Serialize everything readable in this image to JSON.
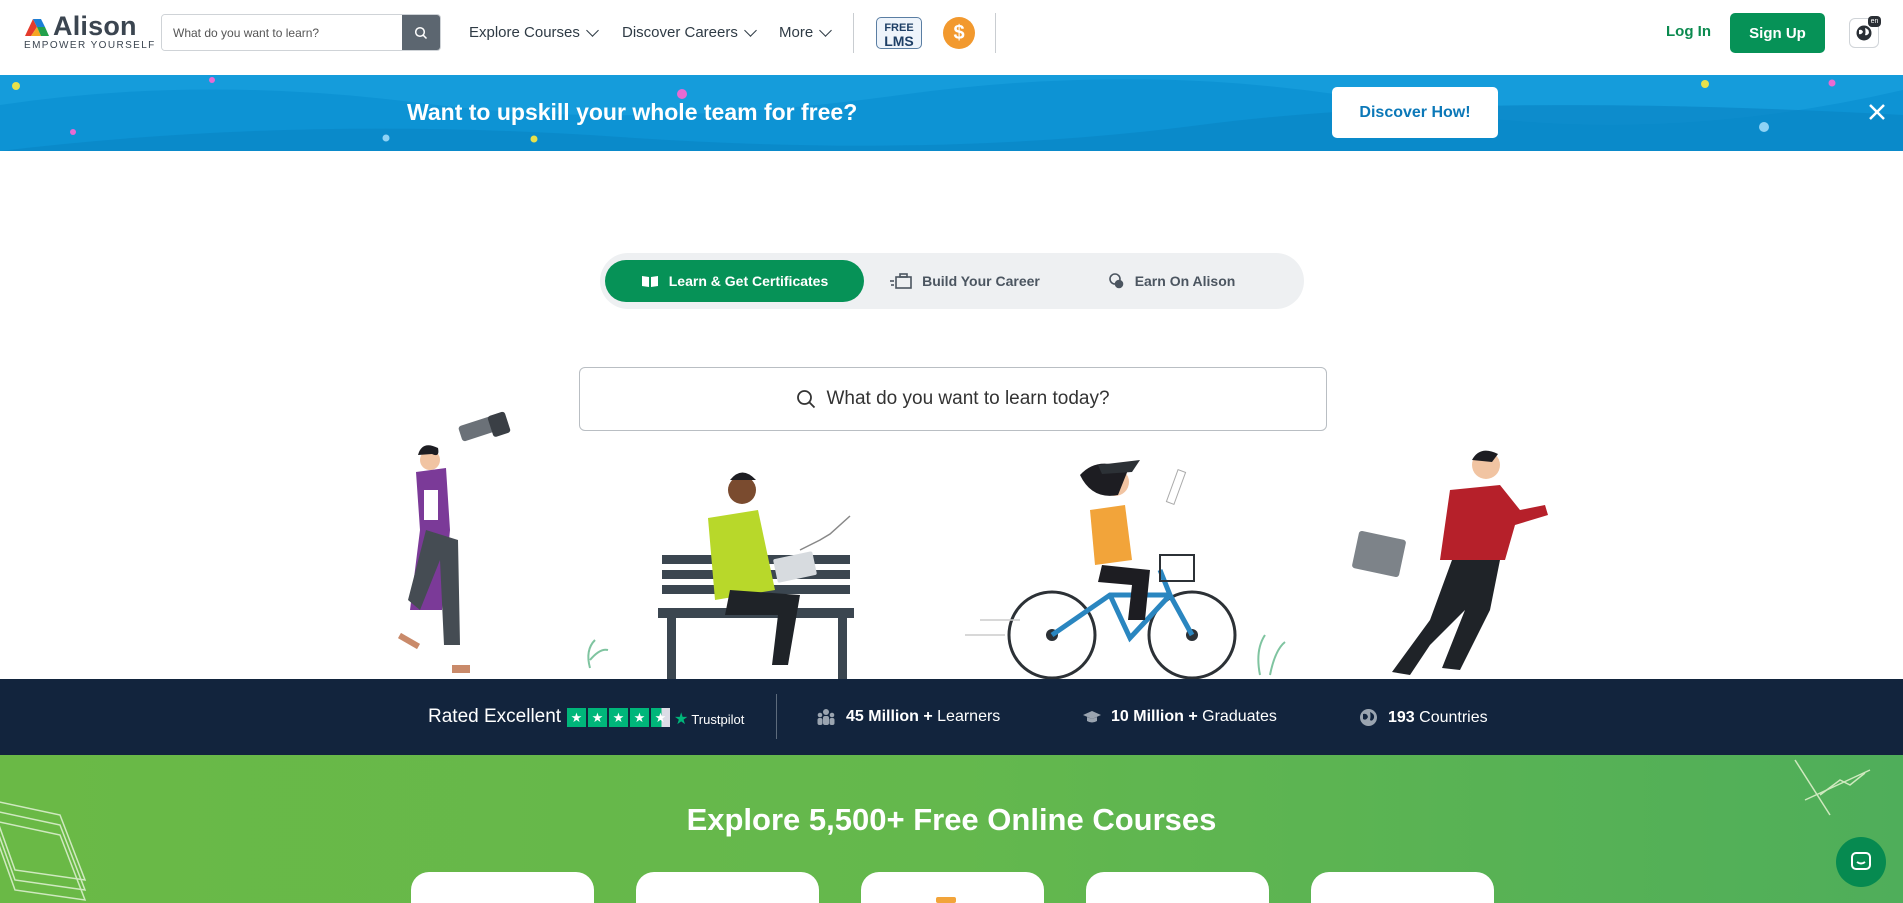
{
  "header": {
    "logo_name": "Alison",
    "logo_tagline": "EMPOWER YOURSELF",
    "search_placeholder": "What do you want to learn?",
    "nav": [
      "Explore Courses",
      "Discover Careers",
      "More"
    ],
    "free_lms_top": "FREE",
    "free_lms_bottom": "LMS",
    "coin_symbol": "$",
    "login_label": "Log In",
    "signup_label": "Sign Up",
    "language_badge": "en"
  },
  "banner": {
    "text": "Want to upskill your whole team for free?",
    "cta_label": "Discover How!",
    "close_icon": "close-icon"
  },
  "tabs": [
    {
      "label": "Learn & Get Certificates",
      "icon": "book-icon",
      "active": true
    },
    {
      "label": "Build Your Career",
      "icon": "briefcase-icon",
      "active": false
    },
    {
      "label": "Earn On Alison",
      "icon": "coins-icon",
      "active": false
    }
  ],
  "hero": {
    "search_text": "What do you want to learn today?"
  },
  "stats": {
    "rated_label": "Rated Excellent",
    "stars": 4.5,
    "trustpilot_label": "Trustpilot",
    "learners_value": "45 Million +",
    "learners_label": "Learners",
    "graduates_value": "10 Million +",
    "graduates_label": "Graduates",
    "countries_value": "193",
    "countries_label": "Countries"
  },
  "explore": {
    "heading": "Explore 5,500+ Free Online Courses"
  },
  "colors": {
    "brand_green": "#069257",
    "banner_blue": "#0d93d4",
    "stats_navy": "#12243d",
    "trustpilot_green": "#00b67a",
    "coin_orange": "#f2992e"
  }
}
